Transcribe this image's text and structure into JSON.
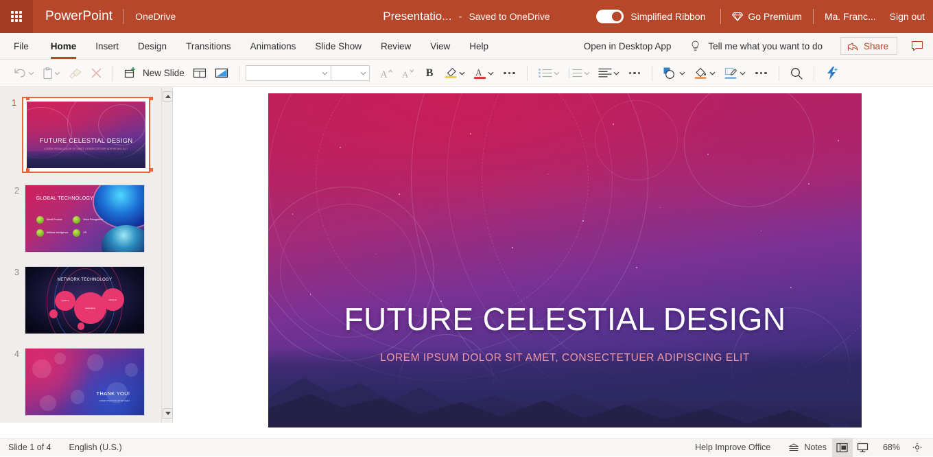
{
  "titlebar": {
    "waffle_icon": "app-launcher-icon",
    "app_name": "PowerPoint",
    "cloud_location": "OneDrive",
    "document_title": "Presentatio...",
    "title_dash": "-",
    "save_state": "Saved to OneDrive",
    "ribbon_toggle_label": "Simplified Ribbon",
    "ribbon_toggle_on": true,
    "go_premium": "Go Premium",
    "premium_icon": "diamond-icon",
    "user_name": "Ma. Franc...",
    "sign_out": "Sign out",
    "bg_color": "#b7472a"
  },
  "ribbon": {
    "tabs": [
      {
        "label": "File",
        "active": false
      },
      {
        "label": "Home",
        "active": true
      },
      {
        "label": "Insert",
        "active": false
      },
      {
        "label": "Design",
        "active": false
      },
      {
        "label": "Transitions",
        "active": false
      },
      {
        "label": "Animations",
        "active": false
      },
      {
        "label": "Slide Show",
        "active": false
      },
      {
        "label": "Review",
        "active": false
      },
      {
        "label": "View",
        "active": false
      },
      {
        "label": "Help",
        "active": false
      }
    ],
    "open_desktop": "Open in Desktop App",
    "tellme_icon": "lightbulb-icon",
    "tellme_placeholder": "Tell me what you want to do",
    "share_label": "Share",
    "share_icon": "share-icon",
    "comment_icon": "comment-icon",
    "accent_color": "#b7472a"
  },
  "toolbar": {
    "undo_icon": "undo-icon",
    "paste_icon": "paste-icon",
    "format_painter_icon": "format-painter-icon",
    "cut_icon": "cut-close-icon",
    "new_slide_icon": "new-slide-icon",
    "new_slide_label": "New Slide",
    "layout_icon": "slide-layout-icon",
    "designer_icon": "picture-design-icon",
    "font_name_value": "",
    "font_name_placeholder": "",
    "font_size_value": "",
    "grow_font_icon": "grow-font-icon",
    "shrink_font_icon": "shrink-font-icon",
    "bold_label": "B",
    "highlight_icon": "text-highlight-icon",
    "font_color_icon": "font-color-icon",
    "more_font_icon": "more-font-options-icon",
    "bullets_icon": "bullets-icon",
    "numbering_icon": "numbering-icon",
    "align_icon": "align-left-icon",
    "more_paragraph_icon": "more-paragraph-options-icon",
    "shapes_icon": "shapes-icon",
    "shape_fill_icon": "shape-fill-icon",
    "shape_outline_icon": "shape-outline-icon",
    "more_drawing_icon": "more-drawing-options-icon",
    "find_icon": "search-icon",
    "designer_flash_icon": "designer-lightning-icon"
  },
  "thumbnails": {
    "scroll_up_icon": "scroll-up-arrow-icon",
    "scroll_down_icon": "scroll-down-arrow-icon",
    "slides": [
      {
        "number": "1",
        "selected": true,
        "title": "FUTURE CELESTIAL DESIGN",
        "subtitle": "LOREM IPSUM DOLOR SIT AMET, CONSECTETUER ADIPISCING ELIT"
      },
      {
        "number": "2",
        "selected": false,
        "title": "GLOBAL TECHNOLOGY",
        "bullets": [
          "Smart Product",
          "Voice Recognition",
          "Artificial Intelligence",
          "VR"
        ]
      },
      {
        "number": "3",
        "selected": false,
        "title": "NETWORK TECHNOLOGY",
        "nodes": [
          "systems",
          "networking",
          "solutions"
        ]
      },
      {
        "number": "4",
        "selected": false,
        "title": "THANK YOU!",
        "subtitle": "LOREM IPSUM DOLOR SIT AMET"
      }
    ]
  },
  "slide": {
    "title": "FUTURE CELESTIAL DESIGN",
    "subtitle": "LOREM IPSUM DOLOR SIT AMET, CONSECTETUER ADIPISCING ELIT",
    "title_color": "#ffffff",
    "subtitle_color": "#ef98aa"
  },
  "statusbar": {
    "slide_count": "Slide 1 of 4",
    "language": "English (U.S.)",
    "help_improve": "Help Improve Office",
    "notes_icon": "notes-icon",
    "notes_label": "Notes",
    "normal_view_icon": "normal-view-icon",
    "slideshow_view_icon": "slideshow-view-icon",
    "zoom_level": "68%",
    "fit_icon": "fit-to-window-icon"
  }
}
